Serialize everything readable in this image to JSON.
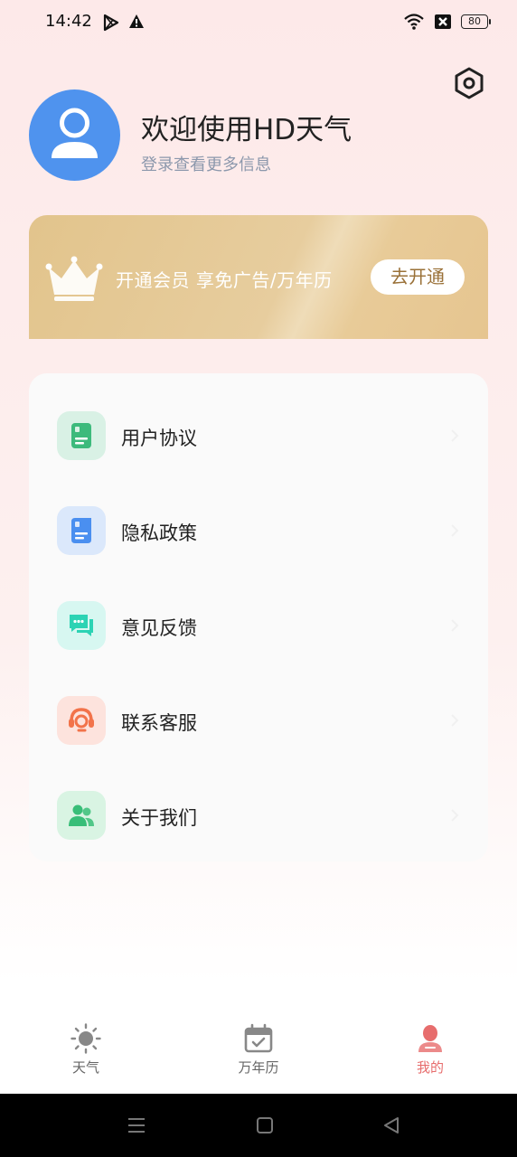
{
  "status_bar": {
    "time": "14:42",
    "battery": "80",
    "icons": [
      "play-store-icon",
      "warning-icon",
      "wifi-icon",
      "no-sim-icon",
      "battery-icon"
    ]
  },
  "header": {
    "title": "欢迎使用HD天气",
    "subtitle": "登录查看更多信息",
    "icons": [
      "settings-icon",
      "user-avatar-icon"
    ]
  },
  "vip_banner": {
    "text": "开通会员 享免广告/万年历",
    "button_label": "去开通",
    "icon": "crown-icon"
  },
  "menu": {
    "items": [
      {
        "label": "用户协议",
        "icon": "document-icon",
        "bg": "#d9f1e5",
        "color": "#3dba7c"
      },
      {
        "label": "隐私政策",
        "icon": "document-icon",
        "bg": "#dbe8fb",
        "color": "#4a8ff0"
      },
      {
        "label": "意见反馈",
        "icon": "chat-icon",
        "bg": "#d7f7f1",
        "color": "#2cd3b4"
      },
      {
        "label": "联系客服",
        "icon": "headset-icon",
        "bg": "#fde3dd",
        "color": "#f2734a"
      },
      {
        "label": "关于我们",
        "icon": "group-icon",
        "bg": "#d9f4e3",
        "color": "#38be78"
      }
    ]
  },
  "tab_bar": {
    "tabs": [
      {
        "label": "天气",
        "icon": "sun-icon"
      },
      {
        "label": "万年历",
        "icon": "calendar-icon"
      },
      {
        "label": "我的",
        "icon": "profile-icon"
      }
    ],
    "active_color": "#e76d6d",
    "inactive_color": "#666666"
  }
}
